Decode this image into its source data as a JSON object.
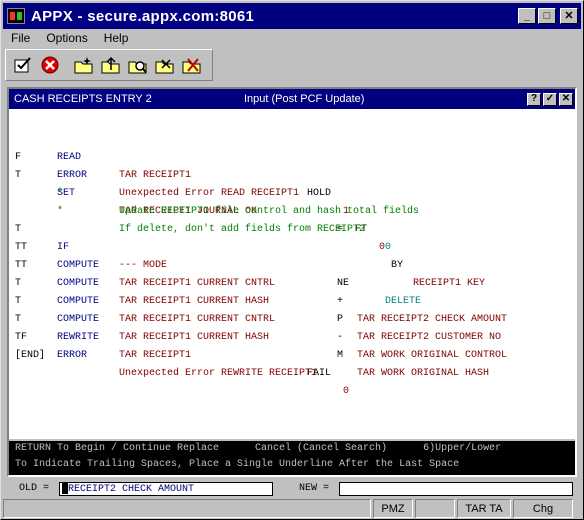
{
  "window": {
    "title": "APPX - secure.appx.com:8061"
  },
  "menu": [
    "File",
    "Options",
    "Help"
  ],
  "toolbar_icons": [
    "checklist-icon",
    "cancel-icon",
    "folder-new-icon",
    "folder-up-icon",
    "folder-search-icon",
    "folder-open-icon",
    "folder-delete-icon"
  ],
  "screen": {
    "name": "CASH RECEIPTS ENTRY 2",
    "mode": "Input (Post PCF Update)",
    "help_btn": "?",
    "ok_btn": "✓",
    "close_btn": "✕"
  },
  "code": [
    {
      "t": "",
      "op": "READ",
      "a": "TAR RECEIPT1",
      "x1": "HOLD",
      "n1": "1",
      "x2": "FT",
      "n2": "0",
      "x3": "BY",
      "b": "RECEIPT1 KEY"
    },
    {
      "t": "F",
      "op": "ERROR",
      "a": "Unexpected Error READ RECEIPT1"
    },
    {
      "t": "T",
      "op": "SET",
      "a": "TAR RECEIPT1 JOURNAL OK",
      "x": "=",
      "b": "0"
    },
    {
      "t": "",
      "op": "*",
      "comment": "Update RECEIPT1 file control and hash total fields"
    },
    {
      "t": "",
      "op": "*",
      "comment": "If delete, don't add fields from RECEIPT2"
    },
    {
      "t": "T",
      "op": "IF",
      "a": "--- MODE",
      "x": "NE",
      "b": "DELETE"
    },
    {
      "t": "TT",
      "op": "COMPUTE",
      "a": "TAR RECEIPT1 CURRENT CNTRL",
      "x": "+",
      "b": "TAR RECEIPT2 CHECK AMOUNT"
    },
    {
      "t": "TT",
      "op": "COMPUTE",
      "a": "TAR RECEIPT1 CURRENT HASH",
      "x": "P",
      "b": "TAR RECEIPT2 CUSTOMER NO"
    },
    {
      "t": "T",
      "op": "COMPUTE",
      "a": "TAR RECEIPT1 CURRENT CNTRL",
      "x": "-",
      "b": "TAR WORK ORIGINAL CONTROL"
    },
    {
      "t": "T",
      "op": "COMPUTE",
      "a": "TAR RECEIPT1 CURRENT HASH",
      "x": "M",
      "b": "TAR WORK ORIGINAL HASH"
    },
    {
      "t": "T",
      "op": "REWRITE",
      "a": "TAR RECEIPT1",
      "x": "FAIL",
      "b": "0"
    },
    {
      "t": "TF",
      "op": "ERROR",
      "a": "Unexpected Error REWRITE RECEIPT1"
    }
  ],
  "end_marker": "[END]",
  "status": {
    "line1": "RETURN To Begin / Continue Replace      Cancel (Cancel Search)      6)Upper/Lower",
    "line2": "To Indicate Trailing Spaces, Place a Single Underline After the Last Space"
  },
  "replace": {
    "old_label": "OLD =",
    "old_value": "RECEIPT2 CHECK AMOUNT",
    "new_label": "NEW =",
    "new_value": ""
  },
  "statusbar": {
    "s1": "",
    "s2": "PMZ",
    "s3": "",
    "s4": "TAR TA",
    "s5": "Chg"
  }
}
